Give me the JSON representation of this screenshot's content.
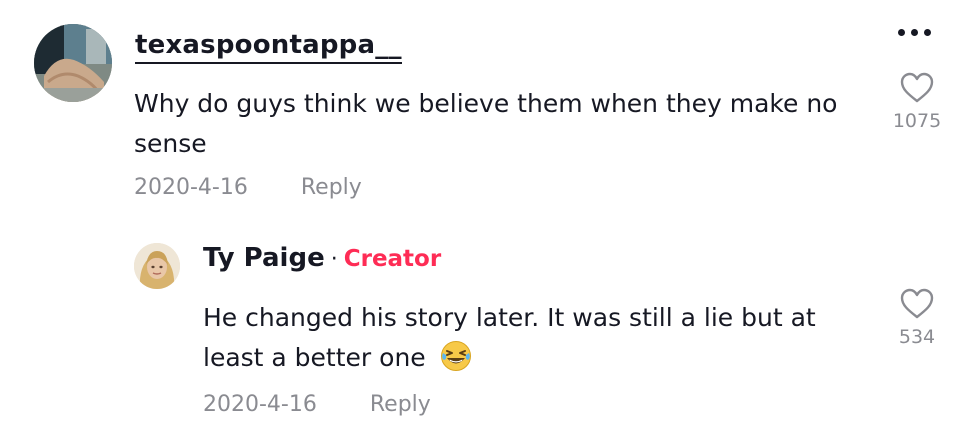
{
  "comment": {
    "username": "texaspoontappa__",
    "text": "Why do guys think we believe them when they make no sense",
    "date": "2020-4-16",
    "reply_label": "Reply",
    "likes": "1075",
    "more_icon": "more-horizontal-icon",
    "like_icon": "heart-outline-icon"
  },
  "reply": {
    "username": "Ty Paige",
    "separator": "·",
    "badge": "Creator",
    "text": "He changed his story later. It was still a lie but at least a better one",
    "emoji": "grinning-squinting-tears-emoji",
    "date": "2020-4-16",
    "reply_label": "Reply",
    "likes": "534",
    "like_icon": "heart-outline-icon"
  },
  "colors": {
    "text": "#161823",
    "secondary": "#8a8b91",
    "creator_accent": "#fe2c55",
    "background": "#ffffff"
  }
}
